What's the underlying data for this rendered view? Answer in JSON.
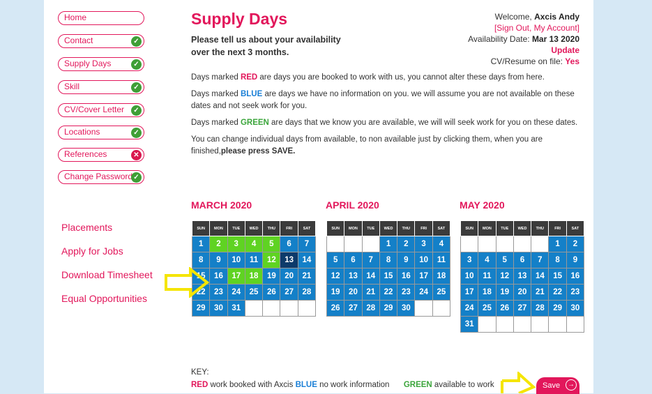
{
  "nav": {
    "buttons": [
      {
        "label": "Home",
        "status": ""
      },
      {
        "label": "Contact",
        "status": "ok"
      },
      {
        "label": "Supply Days",
        "status": "ok"
      },
      {
        "label": "Skill",
        "status": "ok"
      },
      {
        "label": "CV/Cover Letter",
        "status": "ok"
      },
      {
        "label": "Locations",
        "status": "ok"
      },
      {
        "label": "References",
        "status": "bad"
      },
      {
        "label": "Change Password",
        "status": "ok"
      }
    ],
    "links": [
      "Placements",
      "Apply for Jobs",
      "Download Timesheet",
      "Equal Opportunities"
    ]
  },
  "header": {
    "title": "Supply Days",
    "subtitle": "Please tell us about your availability over the next 3 months."
  },
  "user": {
    "welcome_prefix": "Welcome, ",
    "name": "Axcis Andy",
    "account_links": "[Sign Out, My Account]",
    "availability_label": "Availability Date: ",
    "availability_date": "Mar 13 2020",
    "update_label": "Update",
    "cv_label": "CV/Resume on file: ",
    "cv_value": "Yes"
  },
  "instructions": {
    "p1_pre": "Days marked ",
    "p1_color": "RED",
    "p1_post": " are days you are booked to work with us, you cannot alter these days from here.",
    "p2_pre": "Days marked ",
    "p2_color": "BLUE",
    "p2_post": " are days we have no information on you. we will assume you are not available on these dates and not seek work for you.",
    "p3_pre": "Days marked ",
    "p3_color": "GREEN",
    "p3_post": " are days that we know you are available, we will will seek work for you on these dates.",
    "p4_pre": "You can change individual days from available, to non available just by clicking them, when you are finished,",
    "p4_bold": "please press SAVE."
  },
  "weekdays": [
    "SUN",
    "MON",
    "TUE",
    "WED",
    "THU",
    "FRI",
    "SAT"
  ],
  "calendars": [
    {
      "title": "MARCH 2020",
      "offset": 0,
      "days": 31,
      "green": [
        2,
        3,
        4,
        5,
        12,
        17,
        18
      ],
      "dark": [
        13
      ]
    },
    {
      "title": "APRIL 2020",
      "offset": 3,
      "days": 30,
      "green": [],
      "dark": []
    },
    {
      "title": "MAY 2020",
      "offset": 5,
      "days": 31,
      "green": [],
      "dark": []
    }
  ],
  "key": {
    "title": "KEY:",
    "red": "RED",
    "red_text": " work booked with Axcis ",
    "blue": "BLUE",
    "blue_text": " no work information",
    "green": "GREEN",
    "green_text": " available to work"
  },
  "save_label": "Save",
  "colors": {
    "accent": "#e2175b",
    "blue": "#1480c8",
    "green": "#5fd322",
    "booked": "#0d3a6a",
    "annotation": "#f5e500"
  }
}
